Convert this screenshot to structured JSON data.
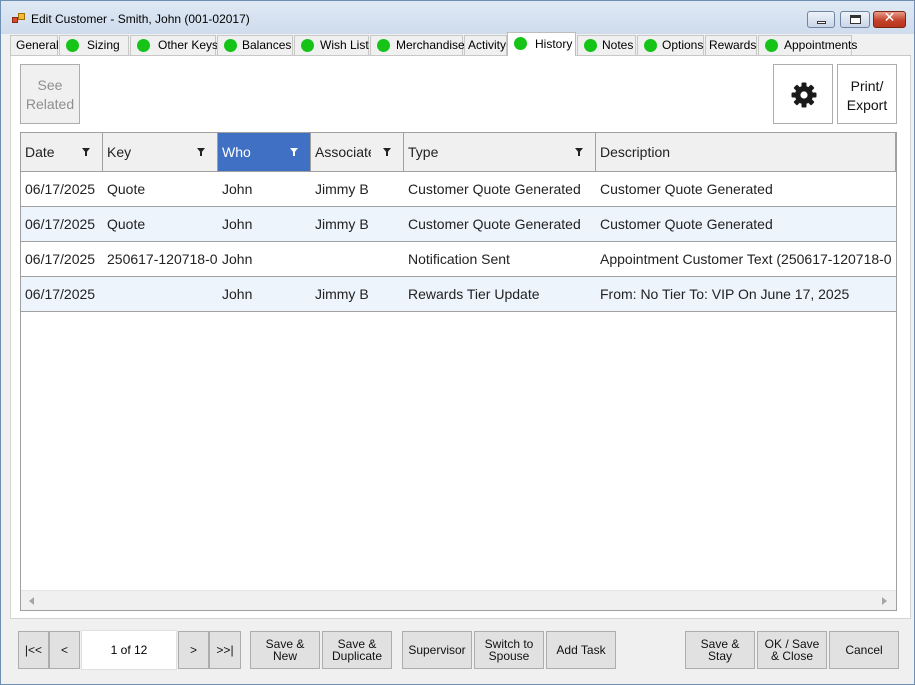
{
  "window": {
    "title": "Edit Customer - Smith, John (001-02017)",
    "controls": {
      "minimize": "minimize-icon",
      "maximize": "maximize-icon",
      "close": "close-icon"
    }
  },
  "tabs": [
    {
      "label": "General",
      "dot": false
    },
    {
      "label": "Sizing",
      "dot": true
    },
    {
      "label": "Other Keys",
      "dot": true
    },
    {
      "label": "Balances",
      "dot": true
    },
    {
      "label": "Wish List",
      "dot": true
    },
    {
      "label": "Merchandise",
      "dot": true
    },
    {
      "label": "Activity",
      "dot": false
    },
    {
      "label": "History",
      "dot": true,
      "active": true
    },
    {
      "label": "Notes",
      "dot": true
    },
    {
      "label": "Options",
      "dot": true
    },
    {
      "label": "Rewards",
      "dot": false
    },
    {
      "label": "Appointments",
      "dot": true
    }
  ],
  "toolbar": {
    "see_related_line1": "See",
    "see_related_line2": "Related",
    "settings_icon": "gear-icon",
    "print_line1": "Print/",
    "print_line2": "Export"
  },
  "grid": {
    "columns": [
      {
        "label": "Date",
        "filter": true
      },
      {
        "label": "Key",
        "filter": true
      },
      {
        "label": "Who",
        "filter": true,
        "selected": true
      },
      {
        "label": "Associate",
        "filter": true
      },
      {
        "label": "Type",
        "filter": true
      },
      {
        "label": "Description",
        "filter": false
      }
    ],
    "rows": [
      [
        "06/17/2025",
        "Quote",
        "John",
        "Jimmy B",
        "Customer Quote Generated",
        "Customer Quote Generated"
      ],
      [
        "06/17/2025",
        "Quote",
        "John",
        "Jimmy B",
        "Customer Quote Generated",
        "Customer Quote Generated"
      ],
      [
        "06/17/2025",
        "250617-120718-0",
        "John",
        "",
        "Notification Sent",
        "Appointment Customer Text (250617-120718-0"
      ],
      [
        "06/17/2025",
        "",
        "John",
        "Jimmy B",
        "Rewards Tier Update",
        "From: No Tier To: VIP On June 17, 2025"
      ]
    ]
  },
  "nav": {
    "first": "|<<",
    "prev": "<",
    "page_text": "1 of  12",
    "next": ">",
    "last": ">>|"
  },
  "actions": {
    "save_new_1": "Save &",
    "save_new_2": "New",
    "save_dup_1": "Save &",
    "save_dup_2": "Duplicate",
    "supervisor": "Supervisor",
    "switch_1": "Switch to",
    "switch_2": "Spouse",
    "add_task": "Add Task",
    "save_stay_1": "Save &",
    "save_stay_2": "Stay",
    "ok_1": "OK / Save",
    "ok_2": "& Close",
    "cancel": "Cancel"
  }
}
